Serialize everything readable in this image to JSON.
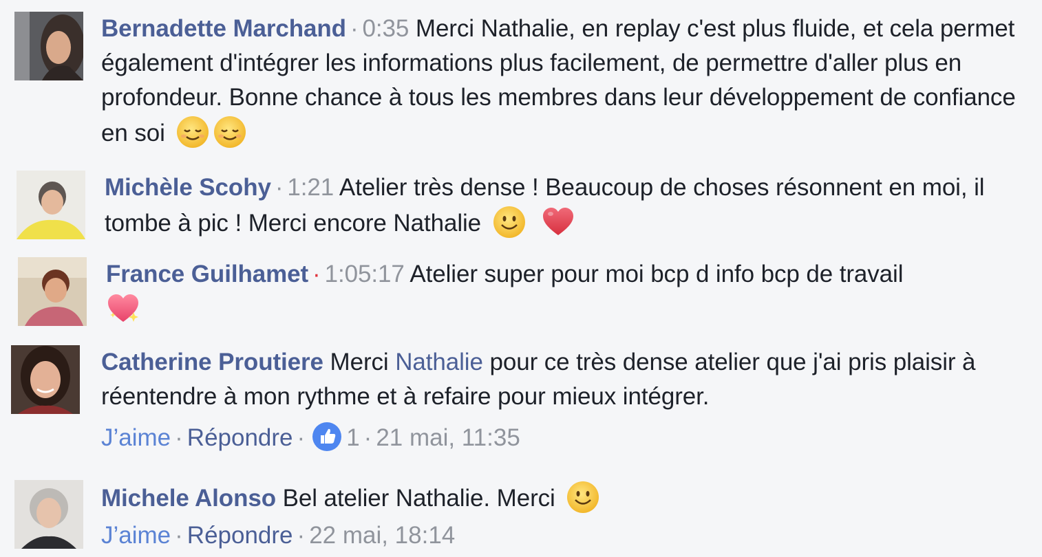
{
  "comments": [
    {
      "author": "Bernadette Marchand",
      "timestamp": "0:35",
      "text": "Merci Nathalie, en replay c'est plus fluide, et cela permet également d'intégrer les informations plus facilement, de permettre d'aller plus en profondeur. Bonne chance à tous les membres dans leur développement de confiance en soi",
      "emojis": [
        "relieved-face-icon",
        "relieved-face-icon"
      ]
    },
    {
      "author": "Michèle Scohy",
      "timestamp": "1:21",
      "text": "Atelier très dense ! Beaucoup de choses résonnent en moi, il tombe à pic ! Merci encore Nathalie",
      "emojis": [
        "smiling-face-icon",
        "red-heart-icon"
      ]
    },
    {
      "author": "France Guilhamet",
      "timestamp": "1:05:17",
      "text": "Atelier super pour moi bcp d info bcp de travail",
      "emojis": [
        "sparkling-heart-icon"
      ]
    },
    {
      "author": "Catherine Proutiere",
      "text_before": "Merci",
      "mention": "Nathalie",
      "text_after": "pour ce très dense atelier que j'ai pris plaisir à réentendre à mon rythme et à refaire pour mieux intégrer.",
      "like_label": "J’aime",
      "reply_label": "Répondre",
      "like_count": "1",
      "date": "21 mai, 11:35"
    },
    {
      "author": "Michele Alonso",
      "text": "Bel atelier Nathalie. Merci",
      "emojis": [
        "smiling-face-icon"
      ],
      "like_label": "J’aime",
      "reply_label": "Répondre",
      "date": "22 mai, 18:14"
    }
  ],
  "separator": "·",
  "colors": {
    "background": "#f5f6f8",
    "author": "#4b5f96",
    "link": "#5b83d4",
    "meta": "#90949c",
    "text": "#1d2129",
    "timestamp_dot_red": "#e0323c",
    "like_blue": "#4e86f0"
  }
}
